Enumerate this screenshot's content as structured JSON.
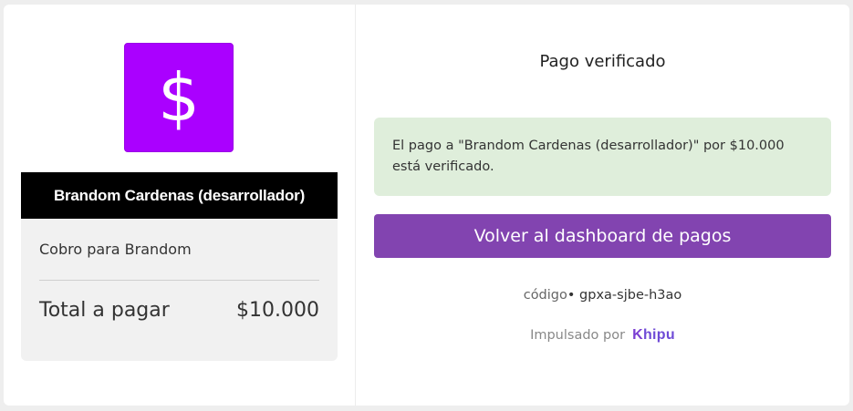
{
  "merchant": {
    "logo_symbol": "$",
    "logo_color": "#aa00ff",
    "name": "Brandom Cardenas (desarrollador)"
  },
  "summary": {
    "subject": "Cobro para Brandom",
    "total_label": "Total a pagar",
    "total_amount": "$10.000"
  },
  "status": {
    "title": "Pago verificado",
    "message": "El pago a \"Brandom Cardenas (desarrollador)\" por $10.000 está verificado.",
    "message_bg": "#dfeedb"
  },
  "actions": {
    "back_label": "Volver al dashboard de pagos",
    "button_color": "#8244b0"
  },
  "payment_code": {
    "label": "código",
    "separator": "•",
    "value": "gpxa-sjbe-h3ao"
  },
  "footer": {
    "powered_label": "Impulsado por",
    "brand_first": "K",
    "brand_rest": "hipu",
    "brand_color": "#7b3fd3"
  }
}
